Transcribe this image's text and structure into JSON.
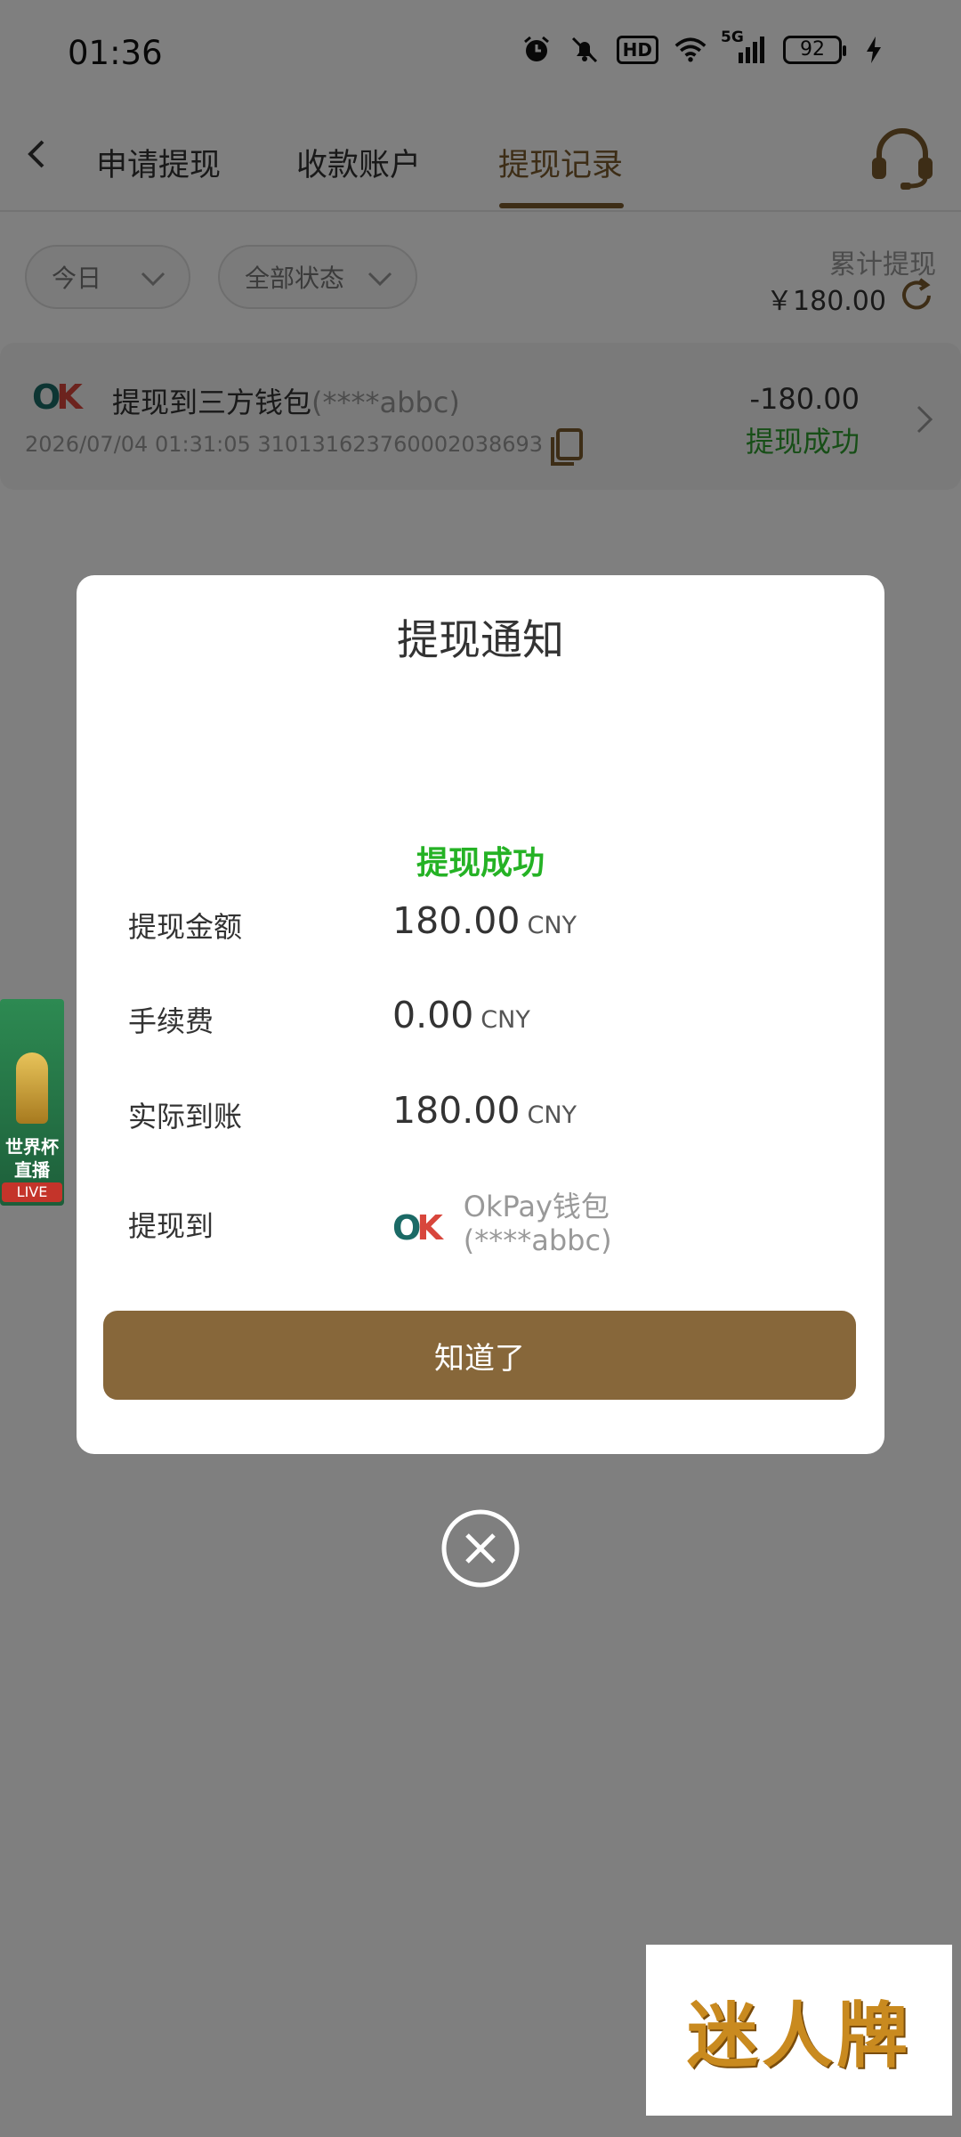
{
  "status_bar": {
    "time": "01:36",
    "battery": "92",
    "hd": "HD",
    "network": "5G",
    "icons": [
      "alarm-icon",
      "mute-bell-icon",
      "hd-icon",
      "wifi-icon",
      "signal-icon",
      "battery-icon",
      "charging-icon"
    ]
  },
  "header": {
    "tabs": [
      {
        "label": "申请提现"
      },
      {
        "label": "收款账户"
      },
      {
        "label": "提现记录"
      }
    ],
    "active_tab": "提现记录",
    "accent_color": "#7a5a2c"
  },
  "filters": {
    "date": "今日",
    "status": "全部状态"
  },
  "summary": {
    "label": "累计提现",
    "amount": "￥180.00"
  },
  "record": {
    "title": "提现到三方钱包",
    "account": "(****abbc)",
    "meta": "2026/07/04 01:31:05 310131623760002038693",
    "amount": "-180.00",
    "status": "提现成功",
    "status_color": "#2e9d2e"
  },
  "side_banner": {
    "line1": "世界杯",
    "line2": "直播",
    "live": "LIVE"
  },
  "modal": {
    "title": "提现通知",
    "status": "提现成功",
    "rows": [
      {
        "label": "提现金额",
        "value": "180.00",
        "unit": "CNY"
      },
      {
        "label": "手续费",
        "value": "0.00",
        "unit": "CNY"
      },
      {
        "label": "实际到账",
        "value": "180.00",
        "unit": "CNY"
      }
    ],
    "to_label": "提现到",
    "wallet_name": "OkPay钱包",
    "wallet_account": "(****abbc)",
    "button_label": "知道了",
    "button_color": "#87673a"
  },
  "logo": {
    "o": "O",
    "k": "K"
  },
  "watermark": "迷人牌"
}
